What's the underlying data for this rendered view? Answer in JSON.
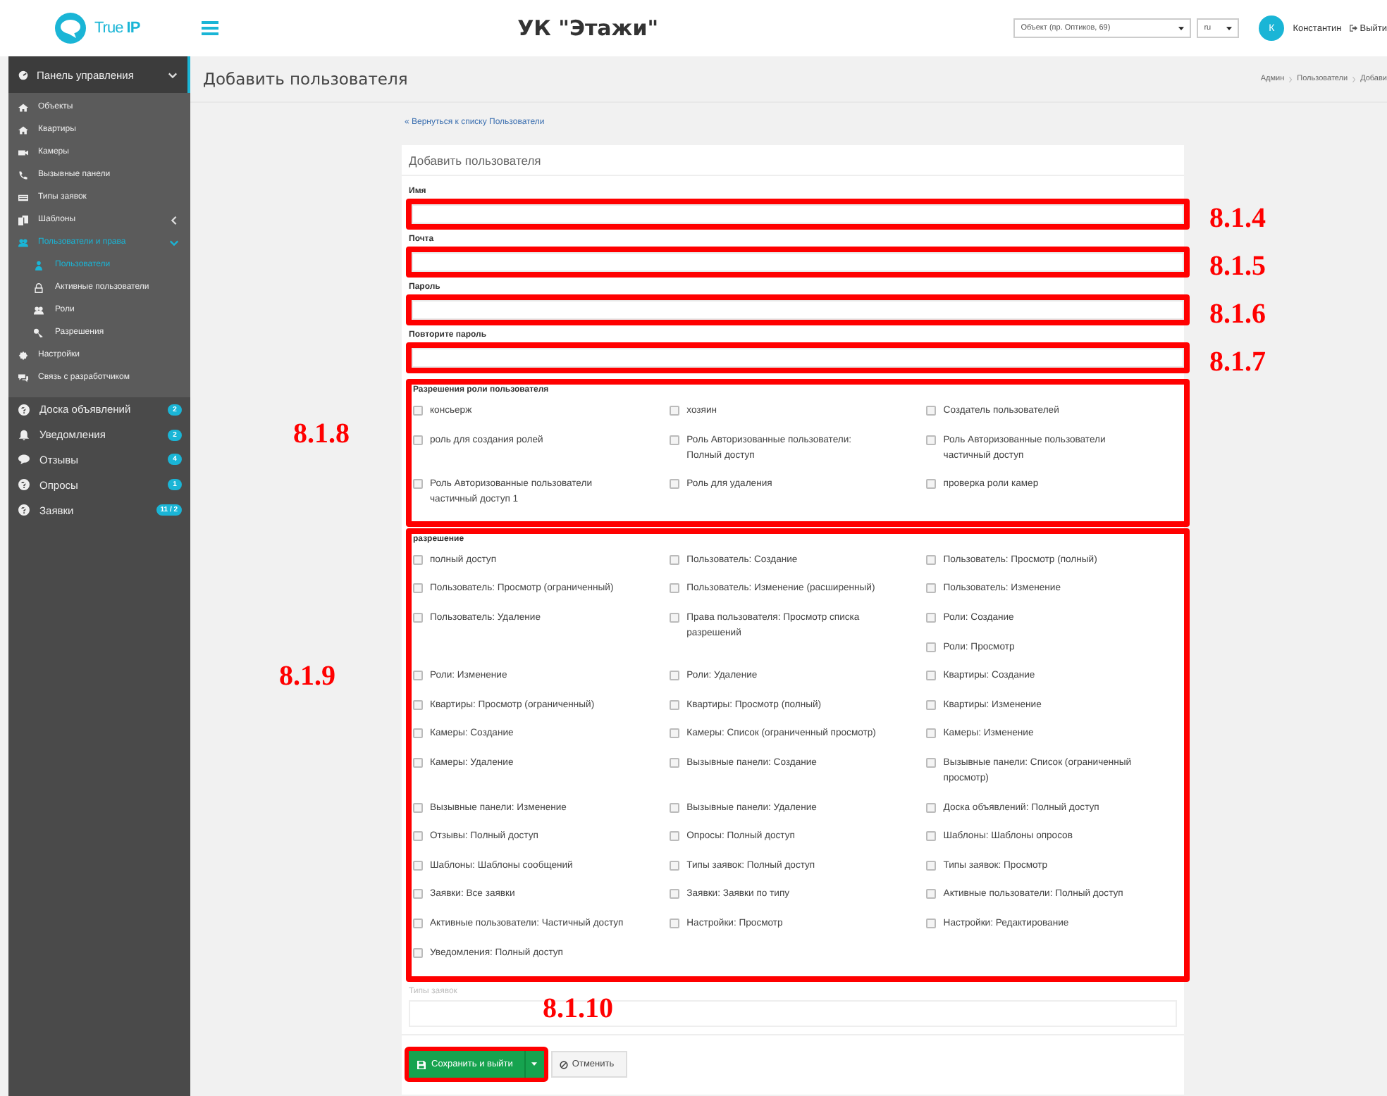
{
  "header": {
    "logo_text": "True",
    "logo_bold": "IP",
    "title": "УК \"Этажи\"",
    "object_select": "Объект (пр. Оптиков, 69)",
    "language_select": "ru",
    "avatar": "К",
    "user_name": "Константин",
    "logout": "Выйти"
  },
  "sidebar": {
    "items": [
      {
        "label": "Панель управления",
        "expanded": true,
        "children": [
          {
            "label": "Объекты"
          },
          {
            "label": "Квартиры"
          },
          {
            "label": "Камеры"
          },
          {
            "label": "Вызывные панели"
          },
          {
            "label": "Типы заявок"
          },
          {
            "label": "Шаблоны",
            "expanded": false
          },
          {
            "label": "Пользователи и права",
            "expanded": true,
            "selected": true,
            "children": [
              {
                "label": "Пользователи",
                "selected": true
              },
              {
                "label": "Активные пользователи",
                "selected": false
              },
              {
                "label": "Роли",
                "selected": false
              },
              {
                "label": "Разрешения",
                "selected": false
              }
            ]
          },
          {
            "label": "Настройки"
          },
          {
            "label": "Связь с разработчиком"
          }
        ]
      },
      {
        "label": "Доска объявлений",
        "badge": "2"
      },
      {
        "label": "Уведомления",
        "badge": "2"
      },
      {
        "label": "Отзывы",
        "badge": "4"
      },
      {
        "label": "Опросы",
        "badge": "1"
      },
      {
        "label": "Заявки",
        "badge": "11 / 2"
      }
    ]
  },
  "page": {
    "title": "Добавить пользователя",
    "breadcrumb": [
      "Админ",
      "Пользователи",
      "Добави"
    ],
    "back_link": "« Вернуться к списку Пользователи"
  },
  "form": {
    "title": "Добавить пользователя",
    "fields": [
      {
        "label": "Имя",
        "annotation": "8.1.4"
      },
      {
        "label": "Почта",
        "annotation": "8.1.5"
      },
      {
        "label": "Пароль",
        "annotation": "8.1.6"
      },
      {
        "label": "Повторите пароль",
        "annotation": "8.1.7"
      }
    ],
    "roles": {
      "title": "Разрешения роли пользователя",
      "annotation": "8.1.8",
      "items": [
        {
          "label": "консьерж",
          "checked": false
        },
        {
          "label": "хозяин",
          "checked": false
        },
        {
          "label": "Создатель пользователей",
          "checked": false
        },
        {
          "label": "роль для создания ролей",
          "checked": false
        },
        {
          "label": "Роль Авторизованные пользователи: Полный доступ",
          "checked": false
        },
        {
          "label": "Роль Авторизованные пользователи частичный доступ",
          "checked": false
        },
        {
          "label": "Роль Авторизованные пользователи частичный доступ 1",
          "checked": false
        },
        {
          "label": "Роль для удаления",
          "checked": false
        },
        {
          "label": "проверка роли камер",
          "checked": false
        }
      ]
    },
    "permissions": {
      "title": "разрешение",
      "annotation": "8.1.9",
      "items": [
        {
          "label": "полный доступ",
          "checked": false
        },
        {
          "label": "Пользователь: Создание",
          "checked": false
        },
        {
          "label": "Пользователь: Просмотр (полный)",
          "checked": false
        },
        {
          "label": "Пользователь: Просмотр (ограниченный)",
          "checked": false
        },
        {
          "label": "Пользователь: Изменение (расширенный)",
          "checked": false
        },
        {
          "label": "Пользователь: Изменение",
          "checked": false
        },
        {
          "label": "Пользователь: Удаление",
          "checked": false
        },
        {
          "label": "Права пользователя: Просмотр списка разрешений",
          "checked": false
        },
        {
          "label": "Роли: Создание",
          "checked": false
        },
        {
          "label": "Роли: Просмотр",
          "checked": false
        },
        {
          "label": "Роли: Изменение",
          "checked": false
        },
        {
          "label": "Роли: Удаление",
          "checked": false
        },
        {
          "label": "Квартиры: Создание",
          "checked": false
        },
        {
          "label": "Квартиры: Просмотр (ограниченный)",
          "checked": false
        },
        {
          "label": "Квартиры: Просмотр (полный)",
          "checked": false
        },
        {
          "label": "Квартиры: Изменение",
          "checked": false
        },
        {
          "label": "Камеры: Создание",
          "checked": false
        },
        {
          "label": "Камеры: Список (ограниченный просмотр)",
          "checked": false
        },
        {
          "label": "Камеры: Изменение",
          "checked": false
        },
        {
          "label": "Камеры: Удаление",
          "checked": false
        },
        {
          "label": "Вызывные панели: Создание",
          "checked": false
        },
        {
          "label": "Вызывные панели: Список (ограниченный просмотр)",
          "checked": false
        },
        {
          "label": "Вызывные панели: Изменение",
          "checked": false
        },
        {
          "label": "Вызывные панели: Удаление",
          "checked": false
        },
        {
          "label": "Доска объявлений: Полный доступ",
          "checked": false
        },
        {
          "label": "Отзывы: Полный доступ",
          "checked": false
        },
        {
          "label": "Опросы: Полный доступ",
          "checked": false
        },
        {
          "label": "Шаблоны: Шаблоны опросов",
          "checked": false
        },
        {
          "label": "Шаблоны: Шаблоны сообщений",
          "checked": false
        },
        {
          "label": "Типы заявок: Полный доступ",
          "checked": false
        },
        {
          "label": "Типы заявок: Просмотр",
          "checked": false
        },
        {
          "label": "Заявки: Все заявки",
          "checked": false
        },
        {
          "label": "Заявки: Заявки по типу",
          "checked": false
        },
        {
          "label": "Активные пользователи: Полный доступ",
          "checked": false
        },
        {
          "label": "Активные пользователи: Частичный доступ",
          "checked": false
        },
        {
          "label": "Настройки: Просмотр",
          "checked": false
        },
        {
          "label": "Настройки: Редактирование",
          "checked": false
        },
        {
          "label": "Уведомления: Полный доступ",
          "checked": false
        }
      ]
    },
    "request_types": {
      "label": "Типы заявок"
    },
    "save_button": "Сохранить и выйти",
    "cancel_button": "Отменить",
    "buttons_annotation": "8.1.10"
  }
}
